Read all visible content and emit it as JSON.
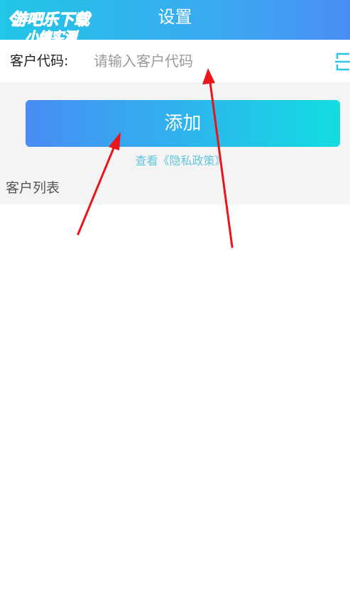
{
  "header": {
    "title": "设置",
    "back_icon": "chevron-left-icon"
  },
  "watermark": {
    "line1": "游吧乐下载",
    "line2": "小编实测"
  },
  "form": {
    "label": "客户代码:",
    "placeholder": "请输入客户代码",
    "scan_icon": "scan-icon"
  },
  "actions": {
    "add_label": "添加",
    "privacy_link": "查看《隐私政策》"
  },
  "list": {
    "title": "客户列表"
  },
  "colors": {
    "header_start": "#22c6e6",
    "header_end": "#4a8ef5",
    "button_start": "#4a8cf5",
    "button_end": "#12dde0",
    "link": "#62c6dc",
    "annotation_arrow": "#e8151b"
  }
}
